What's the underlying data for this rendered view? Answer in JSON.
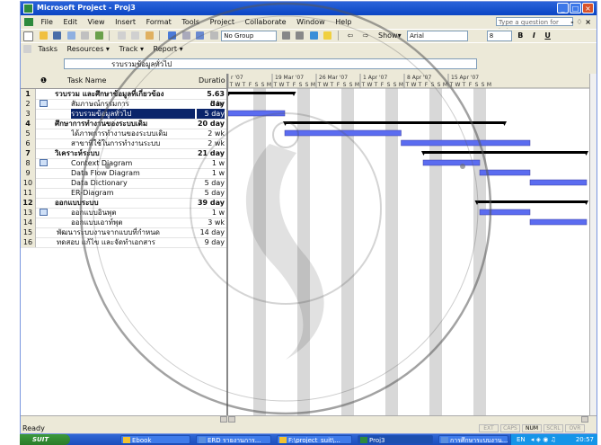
{
  "window": {
    "title": "Microsoft Project - Proj3"
  },
  "menu": [
    "File",
    "Edit",
    "View",
    "Insert",
    "Format",
    "Tools",
    "Project",
    "Collaborate",
    "Window",
    "Help"
  ],
  "ask_question_placeholder": "Type a question for help",
  "toolbar": {
    "no_group": "No Group",
    "show": "Show",
    "font": "Arial",
    "font_size": "8",
    "bold": "B",
    "italic": "I",
    "underline": "U"
  },
  "guide": {
    "tasks": "Tasks",
    "resources": "Resources",
    "track": "Track",
    "report": "Report"
  },
  "entry_text": "รวบรวมข้อมูลทั่วไป",
  "table": {
    "headers": {
      "name": "Task Name",
      "duration": "Duratio"
    },
    "rows": [
      {
        "id": "1",
        "name": "รวบรวม และศึกษาข้อมูลที่เกี่ยวข้อง",
        "duration": "5.63 day",
        "summary": true,
        "indent": 0,
        "note": false
      },
      {
        "id": "2",
        "name": "สัมภาษณ์กรรมการ",
        "duration": "5 hr",
        "summary": false,
        "indent": 1,
        "note": true
      },
      {
        "id": "3",
        "name": "รวบรวมข้อมูลทั่วไป",
        "duration": "5 day",
        "summary": false,
        "indent": 1,
        "note": false,
        "selected": true
      },
      {
        "id": "4",
        "name": "ศึกษาการทำงานของระบบเดิม",
        "duration": "20 day",
        "summary": true,
        "indent": 0,
        "note": false
      },
      {
        "id": "5",
        "name": "ได้ภาพการทำงานของระบบเดิม",
        "duration": "2 wk",
        "summary": false,
        "indent": 1,
        "note": false
      },
      {
        "id": "6",
        "name": "สาขาที่ใช้ในการทำงานระบบ",
        "duration": "2 wk",
        "summary": false,
        "indent": 1,
        "note": false
      },
      {
        "id": "7",
        "name": "วิเคราะห์ระบบ",
        "duration": "21 day",
        "summary": true,
        "indent": 0,
        "note": false
      },
      {
        "id": "8",
        "name": "Context Diagram",
        "duration": "1 w",
        "summary": false,
        "indent": 1,
        "note": true
      },
      {
        "id": "9",
        "name": "Data Flow Diagram",
        "duration": "1 w",
        "summary": false,
        "indent": 1,
        "note": false
      },
      {
        "id": "10",
        "name": "Data Dictionary",
        "duration": "5 day",
        "summary": false,
        "indent": 1,
        "note": false
      },
      {
        "id": "11",
        "name": "ER-Diagram",
        "duration": "5 day",
        "summary": false,
        "indent": 1,
        "note": false
      },
      {
        "id": "12",
        "name": "ออกแบบระบบ",
        "duration": "39 day",
        "summary": true,
        "indent": 0,
        "note": false
      },
      {
        "id": "13",
        "name": "ออกแบบอินพุต",
        "duration": "1 w",
        "summary": false,
        "indent": 1,
        "note": true
      },
      {
        "id": "14",
        "name": "ออกแบบเอาท์พุต",
        "duration": "3 wk",
        "summary": false,
        "indent": 1,
        "note": false
      },
      {
        "id": "15",
        "name": "พัฒนาระบบงานจากแบบที่กำหนด",
        "duration": "14 day",
        "summary": false,
        "indent": 0,
        "note": false
      },
      {
        "id": "16",
        "name": "ทดสอบ แก้ไข และจัดทำเอกสาร",
        "duration": "9 day",
        "summary": false,
        "indent": 0,
        "note": false
      }
    ]
  },
  "gantt": {
    "weeks": [
      "r '07",
      "19 Mar '07",
      "26 Mar '07",
      "1 Apr '07",
      "8 Apr '07",
      "15 Apr '07"
    ],
    "day_letters": [
      "T",
      "W",
      "T",
      "F",
      "S",
      "S",
      "M"
    ],
    "bars": [
      {
        "row": 1,
        "type": "summary",
        "start": 0.0,
        "end": 10.5
      },
      {
        "row": 3,
        "type": "task",
        "start": 0.0,
        "end": 9.0
      },
      {
        "row": 4,
        "type": "summary",
        "start": 9.0,
        "end": 44.0
      },
      {
        "row": 5,
        "type": "task",
        "start": 9.0,
        "end": 27.5
      },
      {
        "row": 6,
        "type": "task",
        "start": 27.5,
        "end": 48.0
      },
      {
        "row": 7,
        "type": "summary",
        "start": 31.0,
        "end": 57.0
      },
      {
        "row": 8,
        "type": "task",
        "start": 31.0,
        "end": 40.0
      },
      {
        "row": 9,
        "type": "task",
        "start": 40.0,
        "end": 48.0
      },
      {
        "row": 10,
        "type": "task",
        "start": 48.0,
        "end": 57.0
      },
      {
        "row": 12,
        "type": "summary",
        "start": 39.5,
        "end": 57.0
      },
      {
        "row": 13,
        "type": "task",
        "start": 40.0,
        "end": 48.0
      },
      {
        "row": 14,
        "type": "task",
        "start": 48.0,
        "end": 57.0
      }
    ]
  },
  "status": {
    "ready": "Ready",
    "indicators": [
      "EXT",
      "CAPS",
      "NUM",
      "SCRL",
      "OVR"
    ]
  },
  "taskbar": {
    "start": "SUIT",
    "items": [
      "Ebook",
      "ERD รายงานการ...",
      "F:\\project_suit\\...",
      "Proj3",
      "การศึกษาระบบงาน..."
    ],
    "lang": "EN",
    "clock": "20:57"
  },
  "colors": {
    "task_bar": "#5b6cf0",
    "summary_bar": "#000000",
    "weekend": "#d8d8d8",
    "selection": "#0a246a",
    "titlebar": "#0b45c4"
  }
}
